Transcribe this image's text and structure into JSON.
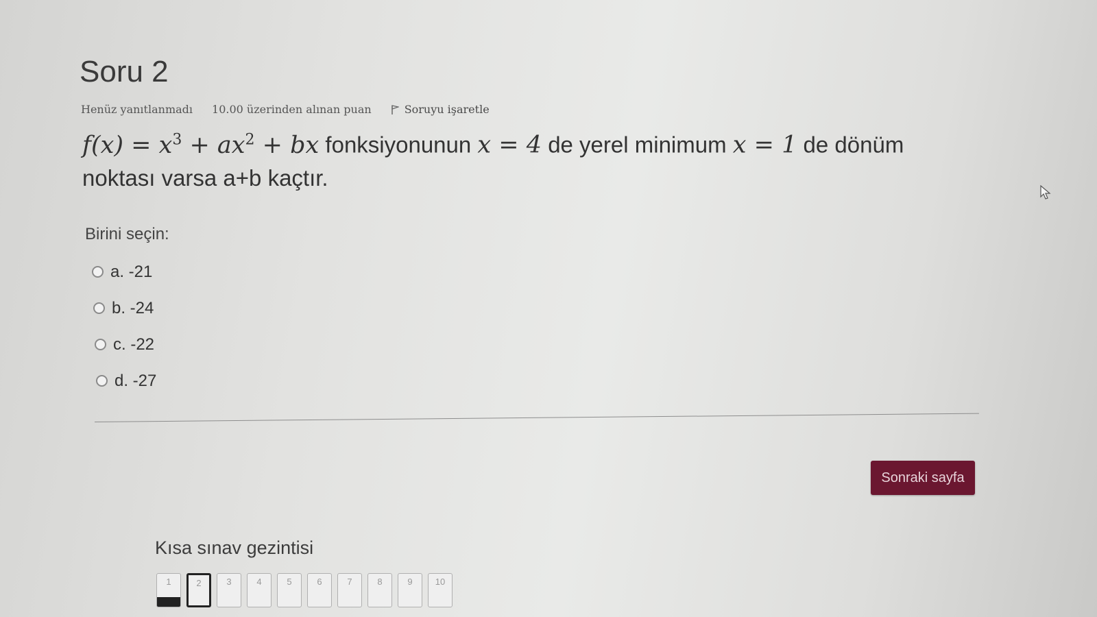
{
  "question": {
    "title": "Soru 2",
    "status": "Henüz yanıtlanmadı",
    "points": "10.00 üzerinden alınan puan",
    "flag_label": "Soruyu işaretle",
    "text_part1": "fonksiyonunun",
    "text_part2": "de yerel minimum",
    "text_part3": "de dönüm noktası varsa a+b kaçtır.",
    "math_fx": "f(x) = x",
    "math_exp3": "3",
    "math_mid": " + ax",
    "math_exp2": "2",
    "math_end": " + bx",
    "math_x4": "x = 4",
    "math_x1": "x = 1"
  },
  "answers": {
    "prompt": "Birini seçin:",
    "options": [
      {
        "label": "a. -21"
      },
      {
        "label": "b. -24"
      },
      {
        "label": "c. -22"
      },
      {
        "label": "d. -27"
      }
    ]
  },
  "next_button": "Sonraki sayfa",
  "quiz_nav": {
    "title": "Kısa sınav gezintisi",
    "items": [
      "1",
      "2",
      "3",
      "4",
      "5",
      "6",
      "7",
      "8",
      "9",
      "10"
    ],
    "answered": [
      "1"
    ],
    "current": "2"
  },
  "colors": {
    "button_bg": "#6b1730",
    "background": "#e2e2e0"
  }
}
